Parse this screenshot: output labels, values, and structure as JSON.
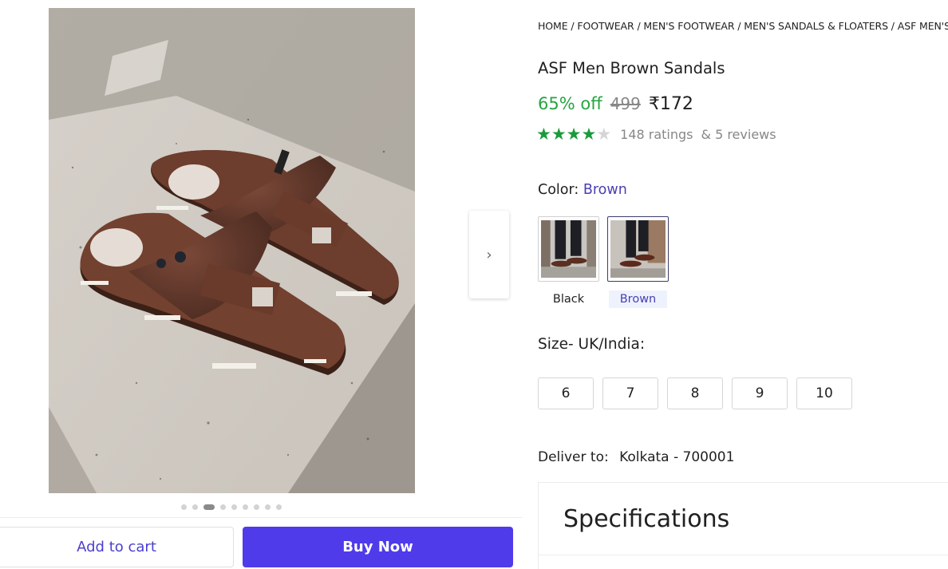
{
  "product": {
    "breadcrumb": "HOME / FOOTWEAR / MEN'S FOOTWEAR / MEN'S SANDALS & FLOATERS / ASF MEN'S",
    "title": "ASF Men Brown Sandals",
    "discount": "65% off",
    "mrp": "499",
    "price": "₹172",
    "rating_value": 4,
    "rating_max": 5,
    "ratings_count": "148 ratings",
    "reviews_count": "& 5 reviews"
  },
  "gallery": {
    "image_icon": "sandals-photo",
    "dots_count": 9,
    "active_dot": 2,
    "next_icon": "chevron-right-icon",
    "next_glyph": "›"
  },
  "color": {
    "label": "Color:",
    "selected": "Brown",
    "options": [
      {
        "label": "Black"
      },
      {
        "label": "Brown"
      }
    ]
  },
  "size": {
    "label": "Size- UK/India:",
    "options": [
      "6",
      "7",
      "8",
      "9",
      "10"
    ]
  },
  "delivery": {
    "label": "Deliver to:",
    "location": "Kolkata - 700001"
  },
  "specs": {
    "title": "Specifications"
  },
  "actions": {
    "add_to_cart": "Add to cart",
    "buy_now": "Buy Now"
  },
  "colors": {
    "accent": "#4f3bea",
    "discount": "#26a541",
    "star": "#1b9a3c",
    "link": "#4a3fb3"
  }
}
